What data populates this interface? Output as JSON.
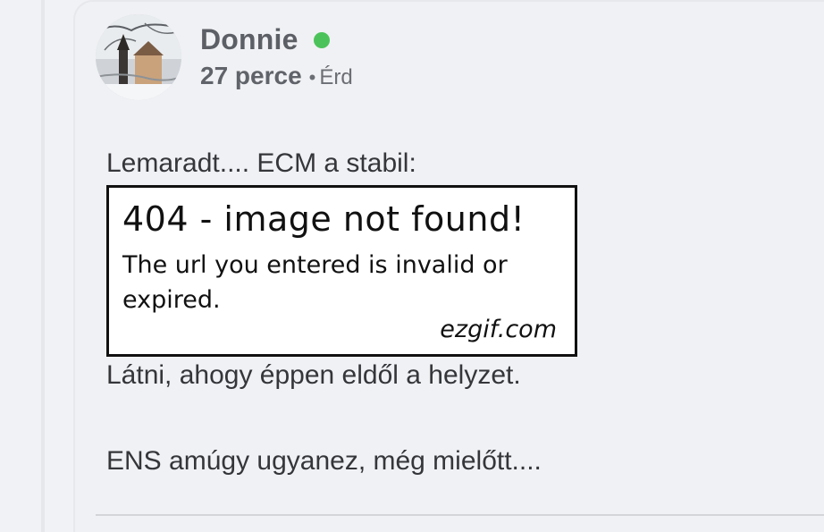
{
  "post": {
    "author": "Donnie",
    "online": true,
    "time": "27 perce",
    "separator": "•",
    "location": "Érd",
    "text_line1": "Lemaradt.... ECM a stabil:",
    "text_line2": "Látni, ahogy éppen eldől a helyzet.",
    "text_line3": "ENS amúgy ugyanez, még mielőtt...."
  },
  "embedded_image": {
    "title": "404 - image not found!",
    "message": "The url you entered is invalid or expired.",
    "brand": "ezgif.com"
  },
  "colors": {
    "online_indicator": "#4cc35a",
    "background": "#f1f2f5",
    "author_text": "#5c5f65",
    "body_text": "#34363a"
  },
  "icons": {
    "avatar": "winter-church-photo-avatar",
    "status": "online-status-dot"
  }
}
